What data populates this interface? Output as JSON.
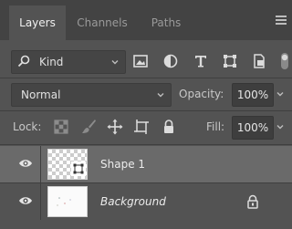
{
  "tabs": [
    {
      "label": "Layers",
      "active": true
    },
    {
      "label": "Channels",
      "active": false
    },
    {
      "label": "Paths",
      "active": false
    }
  ],
  "filter": {
    "kind_label": "Kind",
    "icons": [
      "image-filter-icon",
      "adjustment-filter-icon",
      "type-filter-icon",
      "shape-filter-icon",
      "smart-object-filter-icon",
      "filter-toggle-icon"
    ]
  },
  "blend": {
    "mode": "Normal",
    "opacity_label": "Opacity:",
    "opacity_value": "100%"
  },
  "lock": {
    "label": "Lock:",
    "icons": [
      "lock-transparent-pixels-icon",
      "lock-image-pixels-icon",
      "lock-position-icon",
      "lock-artboard-icon",
      "lock-all-icon"
    ],
    "fill_label": "Fill:",
    "fill_value": "100%"
  },
  "layers": [
    {
      "name": "Shape 1",
      "visible": true,
      "selected": true
    },
    {
      "name": "Background",
      "visible": true,
      "selected": false,
      "locked": true
    }
  ],
  "colors": {
    "panel": "#535353",
    "tabbar": "#434343",
    "selected_row": "#6a6a6a"
  }
}
